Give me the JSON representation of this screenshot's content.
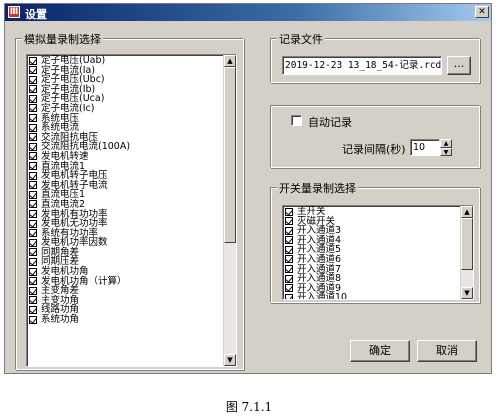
{
  "window": {
    "title": "设置",
    "close_glyph": "✕"
  },
  "analog_group": {
    "label": "模拟量录制选择",
    "items": [
      "定子电压(Uab)",
      "定子电流(Ia)",
      "定子电压(Ubc)",
      "定子电流(Ib)",
      "定子电压(Uca)",
      "定子电流(Ic)",
      "系统电压",
      "系统电流",
      "交流阻抗电压",
      "交流阻抗电流(100A)",
      "发电机转速",
      "直流电流1",
      "发电机转子电压",
      "发电机转子电流",
      "直流电压1",
      "直流电流2",
      "发电机有功功率",
      "发电机无功功率",
      "系统有功功率",
      "发电机功率因数",
      "同期角差",
      "同期压差",
      "发电机功角",
      "发电机功角（计算）",
      "主变角差",
      "主变功角",
      "线路功角",
      "系统功角"
    ]
  },
  "record_file": {
    "label": "记录文件",
    "value": "2019-12-23 13_18_54-记录.rcd",
    "browse_label": "..."
  },
  "auto_record": {
    "label": "自动记录",
    "interval_label": "记录间隔(秒)",
    "interval_value": "10"
  },
  "switch_group": {
    "label": "开关量录制选择",
    "items": [
      "主开关",
      "灭磁开关",
      "开入通道3",
      "开入通道4",
      "开入通道5",
      "开入通道6",
      "开入通道7",
      "开入通道8",
      "开入通道9",
      "开入通道10"
    ]
  },
  "buttons": {
    "ok": "确定",
    "cancel": "取消"
  },
  "caption": "图 7.1.1"
}
